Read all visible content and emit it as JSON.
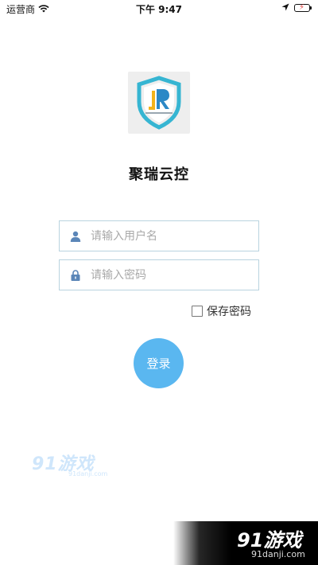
{
  "status_bar": {
    "carrier": "运营商",
    "time": "下午 9:47"
  },
  "app": {
    "title": "聚瑞云控"
  },
  "login_form": {
    "username_placeholder": "请输入用户名",
    "password_placeholder": "请输入密码",
    "remember_label": "保存密码",
    "remember_checked": false,
    "login_label": "登录"
  },
  "colors": {
    "accent": "#5ab7f0",
    "input_border": "#b9d3df",
    "icon": "#5b86b8",
    "logo_shield": "#36b5d2"
  },
  "watermarks": {
    "left_main": "91游戏",
    "left_sub": "91danji.com",
    "right_main": "91游戏",
    "right_sub": "91danji.com"
  }
}
